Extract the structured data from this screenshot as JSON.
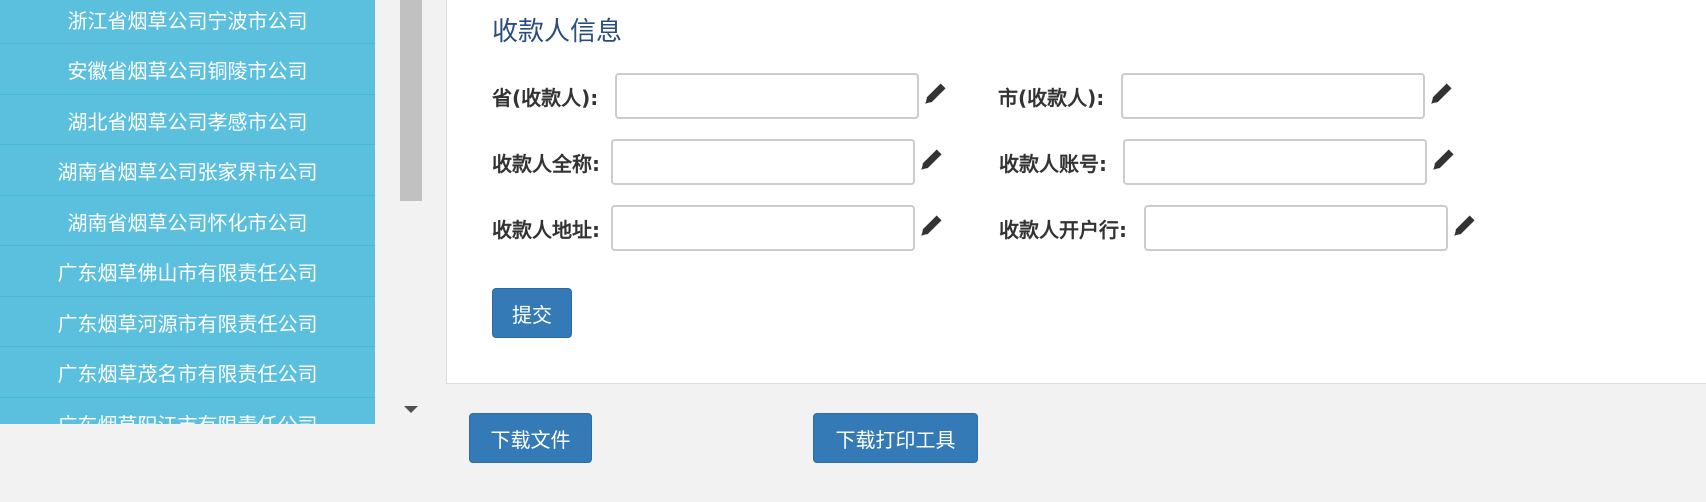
{
  "sidebar": {
    "items": [
      {
        "label": "浙江省烟草公司宁波市公司"
      },
      {
        "label": "安徽省烟草公司铜陵市公司"
      },
      {
        "label": "湖北省烟草公司孝感市公司"
      },
      {
        "label": "湖南省烟草公司张家界市公司"
      },
      {
        "label": "湖南省烟草公司怀化市公司"
      },
      {
        "label": "广东烟草佛山市有限责任公司"
      },
      {
        "label": "广东烟草河源市有限责任公司"
      },
      {
        "label": "广东烟草茂名市有限责任公司"
      },
      {
        "label": "广东烟草阳江市有限责任公司"
      }
    ]
  },
  "form": {
    "title": "收款人信息",
    "fields": {
      "province": {
        "label": "省(收款人):",
        "value": ""
      },
      "city": {
        "label": "市(收款人):",
        "value": ""
      },
      "full_name": {
        "label": "收款人全称:",
        "value": ""
      },
      "account": {
        "label": "收款人账号:",
        "value": ""
      },
      "address": {
        "label": "收款人地址:",
        "value": ""
      },
      "bank": {
        "label": "收款人开户行:",
        "value": ""
      }
    },
    "submit_label": "提交"
  },
  "footer": {
    "download_file_label": "下载文件",
    "download_tool_label": "下载打印工具"
  },
  "colors": {
    "sidebar_bg": "#5bc0de",
    "primary": "#337ab7",
    "title": "#2a4d7f"
  },
  "icons": {
    "edit": "pencil-icon",
    "scroll_down": "triangle-down-icon"
  }
}
